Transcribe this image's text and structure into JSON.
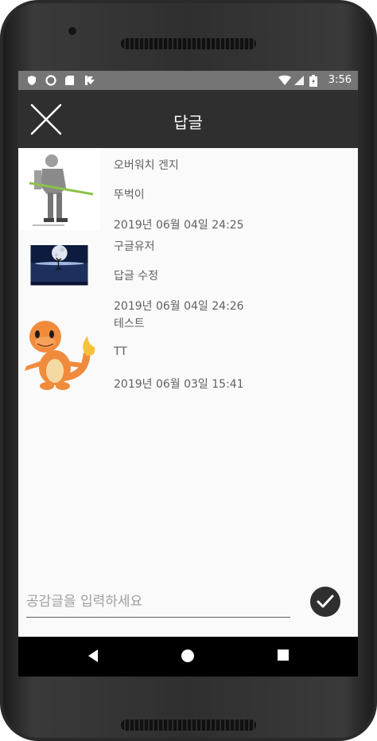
{
  "status_bar": {
    "time": "3:56"
  },
  "app_bar": {
    "title": "답글"
  },
  "replies": [
    {
      "name": "오버워치 겐지",
      "body": "뚜벅이",
      "date": "2019년 06월 04일 24:25"
    },
    {
      "name": "구글유저",
      "body": "답글 수정",
      "date": "2019년 06월 04일 24:26"
    },
    {
      "name": "테스트",
      "body": "TT",
      "date": "2019년 06월 03일 15:41"
    }
  ],
  "composer": {
    "placeholder": "공감글을 입력하세요",
    "value": ""
  },
  "colors": {
    "app_bar": "#2f2f2f",
    "status_bar": "#757575",
    "nav_bar": "#000000",
    "screen_bg": "#fafafa"
  }
}
